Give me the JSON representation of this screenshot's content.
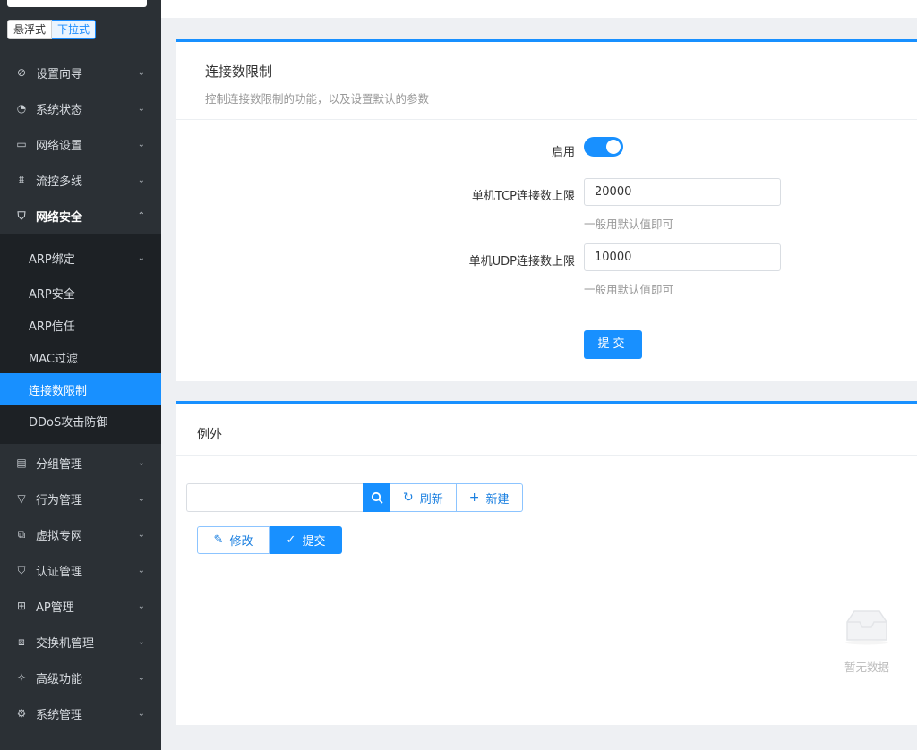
{
  "sidebar": {
    "mode": {
      "floating": "悬浮式",
      "dropdown": "下拉式"
    },
    "items": [
      {
        "icon": "compass-icon",
        "glyph": "⊘",
        "label": "设置向导"
      },
      {
        "icon": "dashboard-icon",
        "glyph": "◔",
        "label": "系统状态"
      },
      {
        "icon": "monitor-icon",
        "glyph": "▭",
        "label": "网络设置"
      },
      {
        "icon": "network-icon",
        "glyph": "⩩",
        "label": "流控多线"
      },
      {
        "icon": "shield-icon",
        "glyph": "⛉",
        "label": "网络安全"
      },
      {
        "icon": "book-icon",
        "glyph": "▤",
        "label": "分组管理"
      },
      {
        "icon": "filter-icon",
        "glyph": "▽",
        "label": "行为管理"
      },
      {
        "icon": "vpn-icon",
        "glyph": "⧉",
        "label": "虚拟专网"
      },
      {
        "icon": "check-shield-icon",
        "glyph": "⛉",
        "label": "认证管理"
      },
      {
        "icon": "sitemap-icon",
        "glyph": "⊞",
        "label": "AP管理"
      },
      {
        "icon": "switch-icon",
        "glyph": "⧈",
        "label": "交换机管理"
      },
      {
        "icon": "pin-icon",
        "glyph": "✧",
        "label": "高级功能"
      },
      {
        "icon": "gear-icon",
        "glyph": "⚙",
        "label": "系统管理"
      }
    ],
    "submenu": [
      {
        "label": "ARP绑定"
      },
      {
        "label": "ARP安全"
      },
      {
        "label": "ARP信任"
      },
      {
        "label": "MAC过滤"
      },
      {
        "label": "连接数限制"
      },
      {
        "label": "DDoS攻击防御"
      }
    ]
  },
  "limit_card": {
    "title": "连接数限制",
    "description": "控制连接数限制的功能，以及设置默认的参数",
    "enable_label": "启用",
    "enabled": true,
    "tcp_label": "单机TCP连接数上限",
    "tcp_value": "20000",
    "tcp_hint": "一般用默认值即可",
    "udp_label": "单机UDP连接数上限",
    "udp_value": "10000",
    "udp_hint": "一般用默认值即可",
    "submit_label": "提交"
  },
  "exception_card": {
    "title": "例外",
    "search_value": "",
    "refresh_label": "刷新",
    "new_label": "新建",
    "edit_label": "修改",
    "commit_label": "提交",
    "empty_text": "暂无数据"
  },
  "colors": {
    "accent": "#1890ff",
    "sidebar_bg": "#2b3035",
    "submenu_bg": "#1d2125"
  }
}
